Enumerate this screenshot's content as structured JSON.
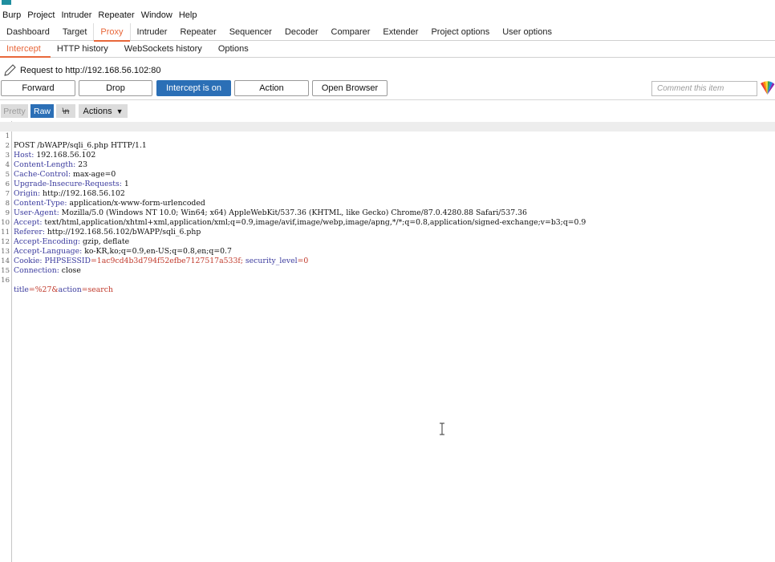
{
  "menu": [
    "Burp",
    "Project",
    "Intruder",
    "Repeater",
    "Window",
    "Help"
  ],
  "main_tabs": [
    "Dashboard",
    "Target",
    "Proxy",
    "Intruder",
    "Repeater",
    "Sequencer",
    "Decoder",
    "Comparer",
    "Extender",
    "Project options",
    "User options"
  ],
  "main_active": "Proxy",
  "sub_tabs": [
    "Intercept",
    "HTTP history",
    "WebSockets history",
    "Options"
  ],
  "sub_active": "Intercept",
  "request_info": "Request to http://192.168.56.102:80",
  "toolbar": {
    "forward": "Forward",
    "drop": "Drop",
    "intercept": "Intercept is on",
    "action": "Action",
    "open_browser": "Open Browser",
    "comment_placeholder": "Comment this item"
  },
  "view_buttons": {
    "pretty": "Pretty",
    "raw": "Raw",
    "wn": "\\n",
    "actions": "Actions"
  },
  "request_lines": [
    {
      "n": "1",
      "name": "",
      "value": "POST /bWAPP/sqli_6.php HTTP/1.1"
    },
    {
      "n": "2",
      "name": "Host:",
      "value": " 192.168.56.102"
    },
    {
      "n": "3",
      "name": "Content-Length:",
      "value": " 23"
    },
    {
      "n": "4",
      "name": "Cache-Control:",
      "value": " max-age=0"
    },
    {
      "n": "5",
      "name": "Upgrade-Insecure-Requests:",
      "value": " 1"
    },
    {
      "n": "6",
      "name": "Origin:",
      "value": " http://192.168.56.102"
    },
    {
      "n": "7",
      "name": "Content-Type:",
      "value": " application/x-www-form-urlencoded"
    },
    {
      "n": "8",
      "name": "User-Agent:",
      "value": " Mozilla/5.0 (Windows NT 10.0; Win64; x64) AppleWebKit/537.36 (KHTML, like Gecko) Chrome/87.0.4280.88 Safari/537.36"
    },
    {
      "n": "9",
      "name": "Accept:",
      "value": " text/html,application/xhtml+xml,application/xml;q=0.9,image/avif,image/webp,image/apng,*/*;q=0.8,application/signed-exchange;v=b3;q=0.9"
    },
    {
      "n": "10",
      "name": "Referer:",
      "value": " http://192.168.56.102/bWAPP/sqli_6.php"
    },
    {
      "n": "11",
      "name": "Accept-Encoding:",
      "value": " gzip, deflate"
    },
    {
      "n": "12",
      "name": "Accept-Language:",
      "value": " ko-KR,ko;q=0.9,en-US;q=0.8,en;q=0.7"
    },
    {
      "n": "13",
      "name": "Cookie:",
      "value": " "
    },
    {
      "n": "14",
      "name": "Connection:",
      "value": " close"
    },
    {
      "n": "15",
      "name": "",
      "value": ""
    },
    {
      "n": "16",
      "name": "",
      "value": ""
    }
  ],
  "cookie": {
    "k1": "PHPSESSID",
    "v1": "=1ac9cd4b3d794f52efbe7127517a533f;",
    "k2": " security_level",
    "v2": "=0"
  },
  "body_params": {
    "k1": "title",
    "v1": "=%27&",
    "k2": "action",
    "v2": "=search"
  },
  "colors": {
    "accent_orange": "#e8673a",
    "primary_blue": "#2b6fb6"
  }
}
